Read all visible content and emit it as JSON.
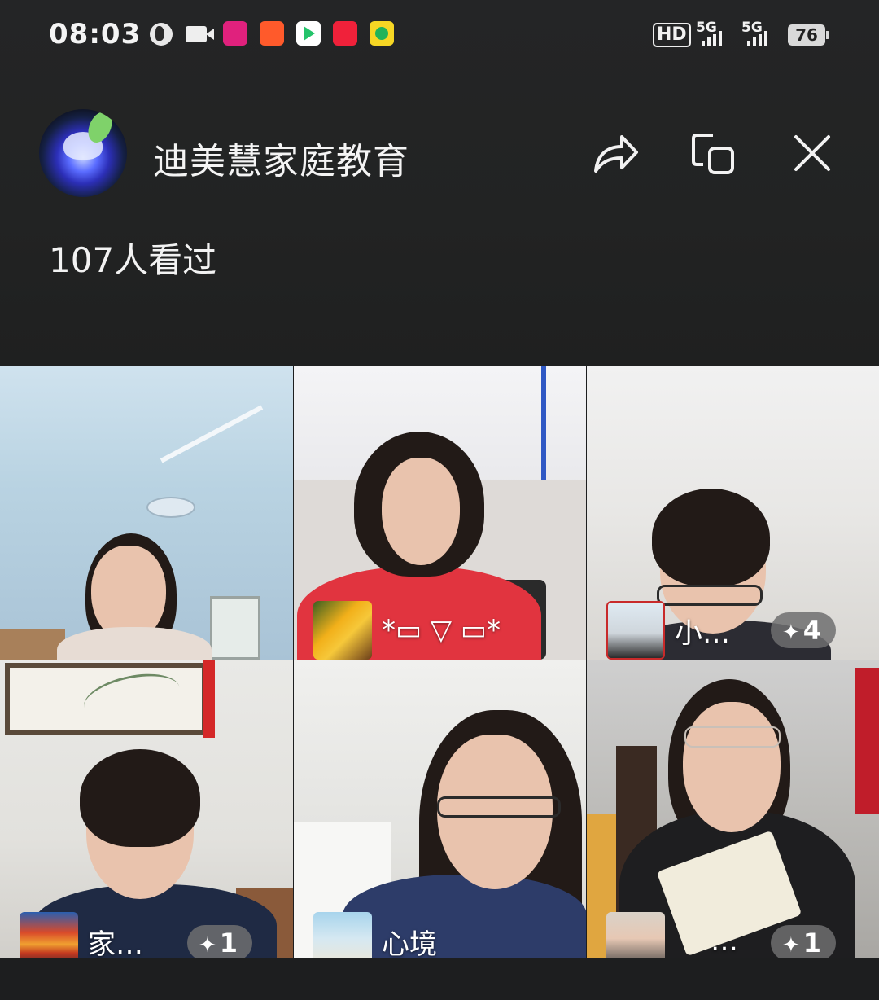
{
  "status_bar": {
    "time": "08:03",
    "hd": "HD",
    "network_1": "5G",
    "network_2": "5G",
    "battery": "76",
    "icons": [
      "globe-icon",
      "video-icon",
      "app-icon",
      "app-icon",
      "app-icon",
      "app-icon",
      "app-icon"
    ]
  },
  "header": {
    "channel_name": "迪美慧家庭教育",
    "viewers": "107人看过",
    "actions": [
      "share-icon",
      "pip-icon",
      "close-icon"
    ]
  },
  "participants": [
    {
      "name": "",
      "badge": ""
    },
    {
      "name": "*▭ ▽ ▭*",
      "badge": ""
    },
    {
      "name": "小…",
      "badge": "4"
    },
    {
      "name": "家…",
      "badge": "1"
    },
    {
      "name": "心境",
      "badge": ""
    },
    {
      "name": "…",
      "badge": "1"
    }
  ],
  "colors": {
    "background": "#1d1e1f",
    "badge": "#6e6e70",
    "text": "#f2f2f2"
  }
}
